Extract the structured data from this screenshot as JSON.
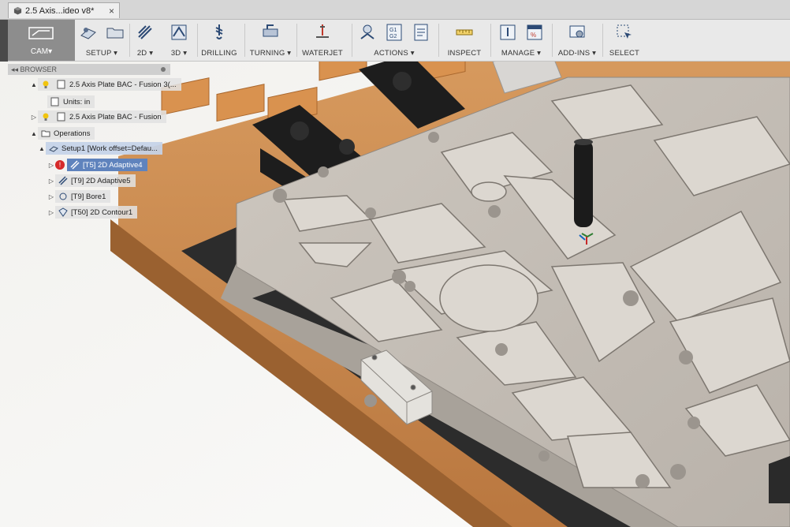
{
  "doc_tab": {
    "title": "2.5 Axis...ideo v8*",
    "close_label": "×"
  },
  "ribbon": {
    "cam_label": "CAM▾",
    "groups": [
      {
        "label": "SETUP ▾"
      },
      {
        "label": "2D ▾"
      },
      {
        "label": "3D ▾"
      },
      {
        "label": "DRILLING"
      },
      {
        "label": "TURNING ▾"
      },
      {
        "label": "WATERJET"
      },
      {
        "label": "ACTIONS ▾"
      },
      {
        "label": "INSPECT"
      },
      {
        "label": "MANAGE ▾"
      },
      {
        "label": "ADD-INS ▾"
      },
      {
        "label": "SELECT"
      }
    ],
    "actions_badges": {
      "g1": "G1",
      "g2": "G2"
    }
  },
  "browser": {
    "header": "◂◂ BROWSER",
    "items": [
      {
        "label": "2.5 Axis Plate BAC - Fusion 3(...",
        "icon": "component-icon"
      },
      {
        "label": "Units: in",
        "icon": "units-icon"
      },
      {
        "label": "2.5 Axis Plate BAC - Fusion",
        "icon": "component-icon"
      },
      {
        "label": "Operations",
        "icon": "folder-icon"
      },
      {
        "label": "Setup1 [Work offset=Defau...",
        "icon": "setup-icon"
      },
      {
        "label": "[T5] 2D Adaptive4",
        "icon": "adaptive-icon"
      },
      {
        "label": "[T9] 2D Adaptive5",
        "icon": "adaptive-icon"
      },
      {
        "label": "[T9] Bore1",
        "icon": "bore-icon"
      },
      {
        "label": "[T50] 2D Contour1",
        "icon": "contour-icon"
      }
    ]
  },
  "colors": {
    "accent_select": "#5f83bd",
    "error": "#d62a2a",
    "wood": "#c98a4e",
    "plate": "#c7c1ba"
  }
}
